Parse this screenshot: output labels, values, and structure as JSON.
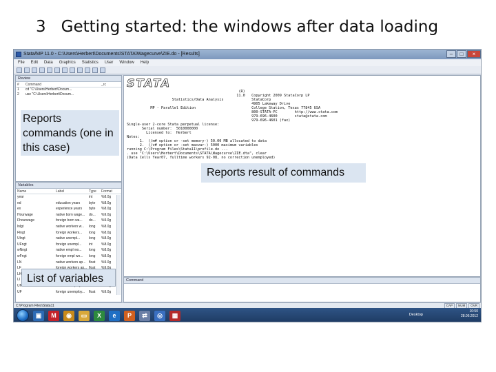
{
  "slide": {
    "number": "3",
    "title": "Getting started:  the windows after data loading"
  },
  "window": {
    "title": "Stata/MP 11.0 - C:\\Users\\Herbert\\Documents\\STATA\\Wagecurve\\ZIE.do - [Results]"
  },
  "menu": [
    "File",
    "Edit",
    "Data",
    "Graphics",
    "Statistics",
    "User",
    "Window",
    "Help"
  ],
  "review": {
    "header": "Review",
    "columns": [
      "#",
      "Command",
      "_rc"
    ],
    "rows": [
      {
        "n": "1",
        "cmd": "cd \"C:\\Users\\Herbert\\Docum..."
      },
      {
        "n": "2",
        "cmd": "use \"C:\\Users\\Herbert\\Docum..."
      }
    ]
  },
  "variables": {
    "header": "Variables",
    "columns": [
      "Name",
      "Label",
      "Type",
      "Format"
    ],
    "rows": [
      {
        "name": "year",
        "label": "",
        "type": "int",
        "format": "%8.0g"
      },
      {
        "name": "ed",
        "label": "education years",
        "type": "byte",
        "format": "%8.0g"
      },
      {
        "name": "ex",
        "label": "experience years",
        "type": "byte",
        "format": "%8.0g"
      },
      {
        "name": "Hourwage",
        "label": "native born wage...",
        "type": "do...",
        "format": "%9.0g"
      },
      {
        "name": "Fhourwage",
        "label": "foreign born wa...",
        "type": "do...",
        "format": "%9.0g"
      },
      {
        "name": "lnlgt",
        "label": "native workers w...",
        "type": "long",
        "format": "%8.0g"
      },
      {
        "name": "Flngt",
        "label": "foreign workers...",
        "type": "long",
        "format": "%8.0g"
      },
      {
        "name": "Ulngt",
        "label": "native unempl...",
        "type": "long",
        "format": "%8.0g"
      },
      {
        "name": "UFngt",
        "label": "foreign unempl...",
        "type": "int",
        "format": "%8.0g"
      },
      {
        "name": "wNngt",
        "label": "native empl wo...",
        "type": "long",
        "format": "%8.0g"
      },
      {
        "name": "wFngt",
        "label": "foreign empl wo...",
        "type": "long",
        "format": "%8.0g"
      },
      {
        "name": "LN",
        "label": "native workers ap...",
        "type": "float",
        "format": "%9.0g"
      },
      {
        "name": "LF",
        "label": "foreign workers ap...",
        "type": "float",
        "format": "%9.0g"
      },
      {
        "name": "LH",
        "label": "",
        "type": "",
        "format": ""
      },
      {
        "name": "LI",
        "label": "",
        "type": "",
        "format": ""
      },
      {
        "name": "UN",
        "label": "native unemploy...",
        "type": "float",
        "format": "%9.0g"
      },
      {
        "name": "UF",
        "label": "foreign unemploy...",
        "type": "float",
        "format": "%9.0g"
      }
    ]
  },
  "results": {
    "header": "(R)",
    "logo": "STATA",
    "lines": [
      "                                                    (R)",
      "                                                   11.0   Copyright 2009 StataCorp LP",
      "                     Statistics/Data Analysis             StataCorp",
      "                                                          4905 Lakeway Drive",
      "           MP - Parallel Edition                          College Station, Texas 77845 USA",
      "                                                          800-STATA-PC        http://www.stata.com",
      "                                                          979-696-4600        stata@stata.com",
      "                                                          979-696-4601 (fax)",
      "",
      "Single-user 2-core Stata perpetual license:",
      "       Serial number:  5010000000",
      "         Licensed to:  Herbert",
      "",
      "Notes:",
      "      1.  (/m# option or -set memory-) 50.00 MB allocated to data",
      "      2.  (/v# option or -set maxvar-) 5000 maximum variables",
      "",
      "running C:\\Program Files\\Stata11\\profile.do ...",
      "",
      ". use \"C:\\Users\\Herbert\\Documents\\STATA\\Wagecurve\\ZIE.dta\", clear",
      "(Data Cells Year07, fulltime workers 92-08, no correction unemployed)"
    ]
  },
  "command": {
    "header": "Command"
  },
  "status": {
    "path": "C:\\Program Files\\Stata11",
    "indicators": [
      "CAP",
      "NUM",
      "OVR"
    ]
  },
  "taskbar": {
    "desktop": "Desktop",
    "time": "10:50",
    "date": "28.06.2012"
  },
  "callouts": {
    "review": "Reports commands (one in this case)",
    "results": "Reports result of commands",
    "variables": "List of variables"
  }
}
